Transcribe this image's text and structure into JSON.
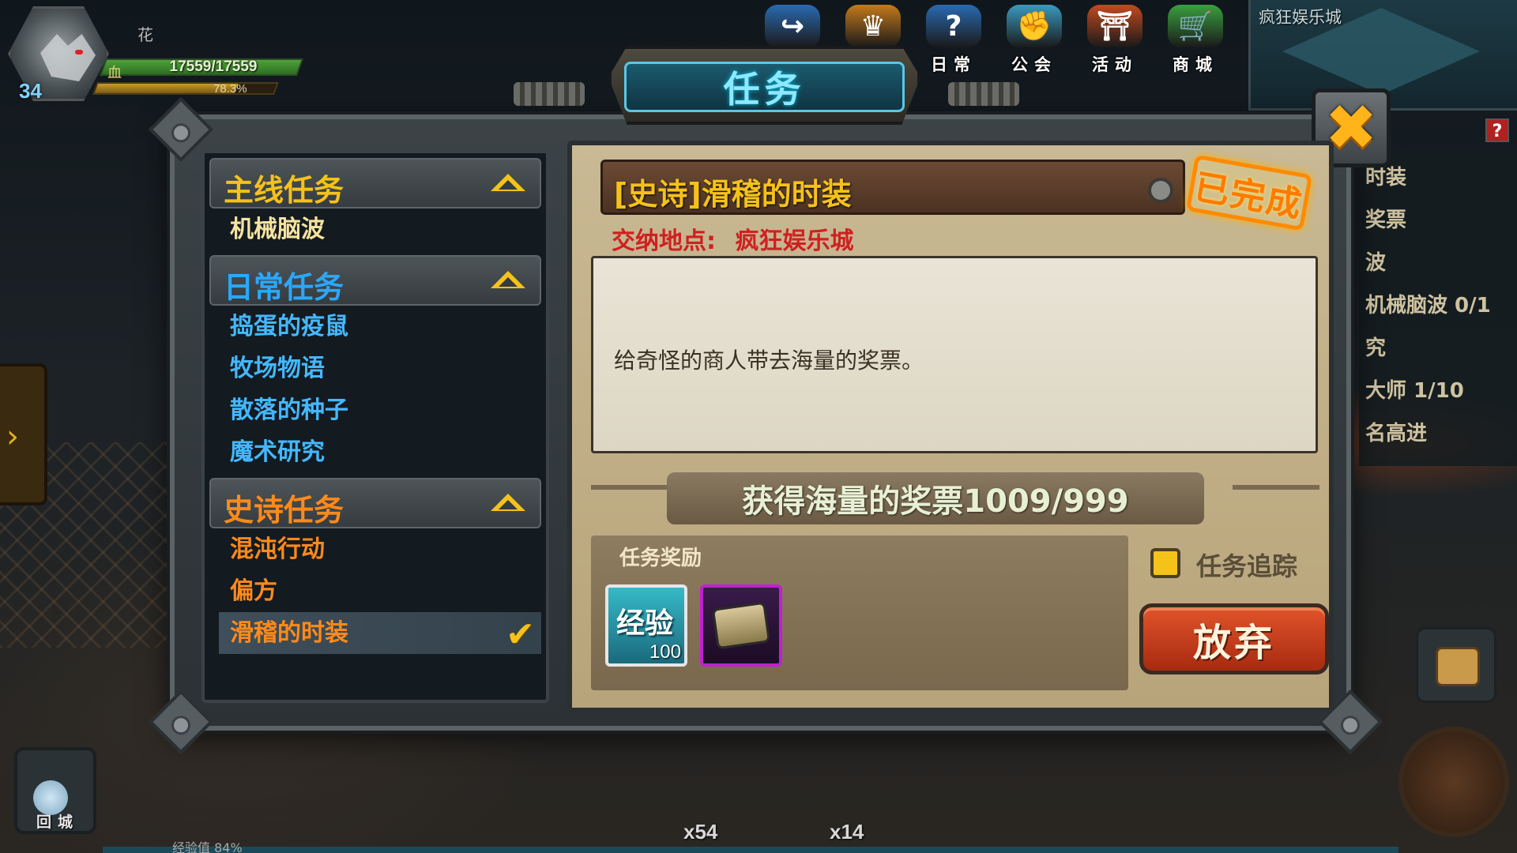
{
  "hud": {
    "level": "34",
    "player_name": "花",
    "hp_icon": "血",
    "hp_text": "17559/17559",
    "hp_fraction": 1.0,
    "xp_text": "78.3%",
    "xp_fraction": 0.783
  },
  "top_menu": [
    {
      "label": "",
      "icon": "share-icon",
      "color": "#2a6ab0"
    },
    {
      "label": "",
      "icon": "crown-icon",
      "color": "#c47a1a"
    },
    {
      "label": "日常",
      "icon": "question-icon",
      "color": "#2a6ab0"
    },
    {
      "label": "公会",
      "icon": "fist-icon",
      "color": "#3a9ac0"
    },
    {
      "label": "活动",
      "icon": "gate-icon",
      "color": "#c24a20"
    },
    {
      "label": "商城",
      "icon": "cart-icon",
      "color": "#3aa040"
    }
  ],
  "minimap": {
    "title": "疯狂娱乐城"
  },
  "tracker": {
    "lines": [
      "时装",
      "奖票",
      "波",
      "机械脑波 0/1",
      "究",
      "大师 1/10",
      "名高进"
    ]
  },
  "dialog": {
    "title": "任务",
    "close_label": "✖"
  },
  "quest_list": {
    "categories": [
      {
        "label": "主线任务",
        "color": "#f5c21a",
        "items": [
          {
            "label": "机械脑波",
            "color": "#f5e3a0"
          }
        ]
      },
      {
        "label": "日常任务",
        "color": "#2aa8ff",
        "items": [
          {
            "label": "捣蛋的疫鼠",
            "color": "#44b8ff"
          },
          {
            "label": "牧场物语",
            "color": "#44b8ff"
          },
          {
            "label": "散落的种子",
            "color": "#44b8ff"
          },
          {
            "label": "魔术研究",
            "color": "#44b8ff"
          }
        ]
      },
      {
        "label": "史诗任务",
        "color": "#ff8a1a",
        "items": [
          {
            "label": "混沌行动",
            "color": "#ff8a1a"
          },
          {
            "label": "偏方",
            "color": "#ff8a1a"
          },
          {
            "label": "滑稽的时装",
            "color": "#ff8a1a",
            "selected": true
          }
        ]
      }
    ]
  },
  "detail": {
    "quest_name": "[史诗]滑稽的时装",
    "status_stamp": "已完成",
    "delivery_label": "交纳地点:",
    "delivery_place": "疯狂娱乐城",
    "description": "给奇怪的商人带去海量的奖票。",
    "progress": "获得海量的奖票1009/999",
    "reward_label": "任务奖励",
    "rewards": [
      {
        "label": "经验",
        "qty": "100",
        "icon": "exp-icon"
      },
      {
        "label": "",
        "qty": "",
        "icon": "costume-box-icon"
      }
    ],
    "track_label": "任务追踪",
    "abandon_label": "放弃"
  },
  "bottom": {
    "return_label": "回城",
    "potion1_count": "x54",
    "potion2_count": "x14",
    "exp_label": "经验值 84%"
  }
}
